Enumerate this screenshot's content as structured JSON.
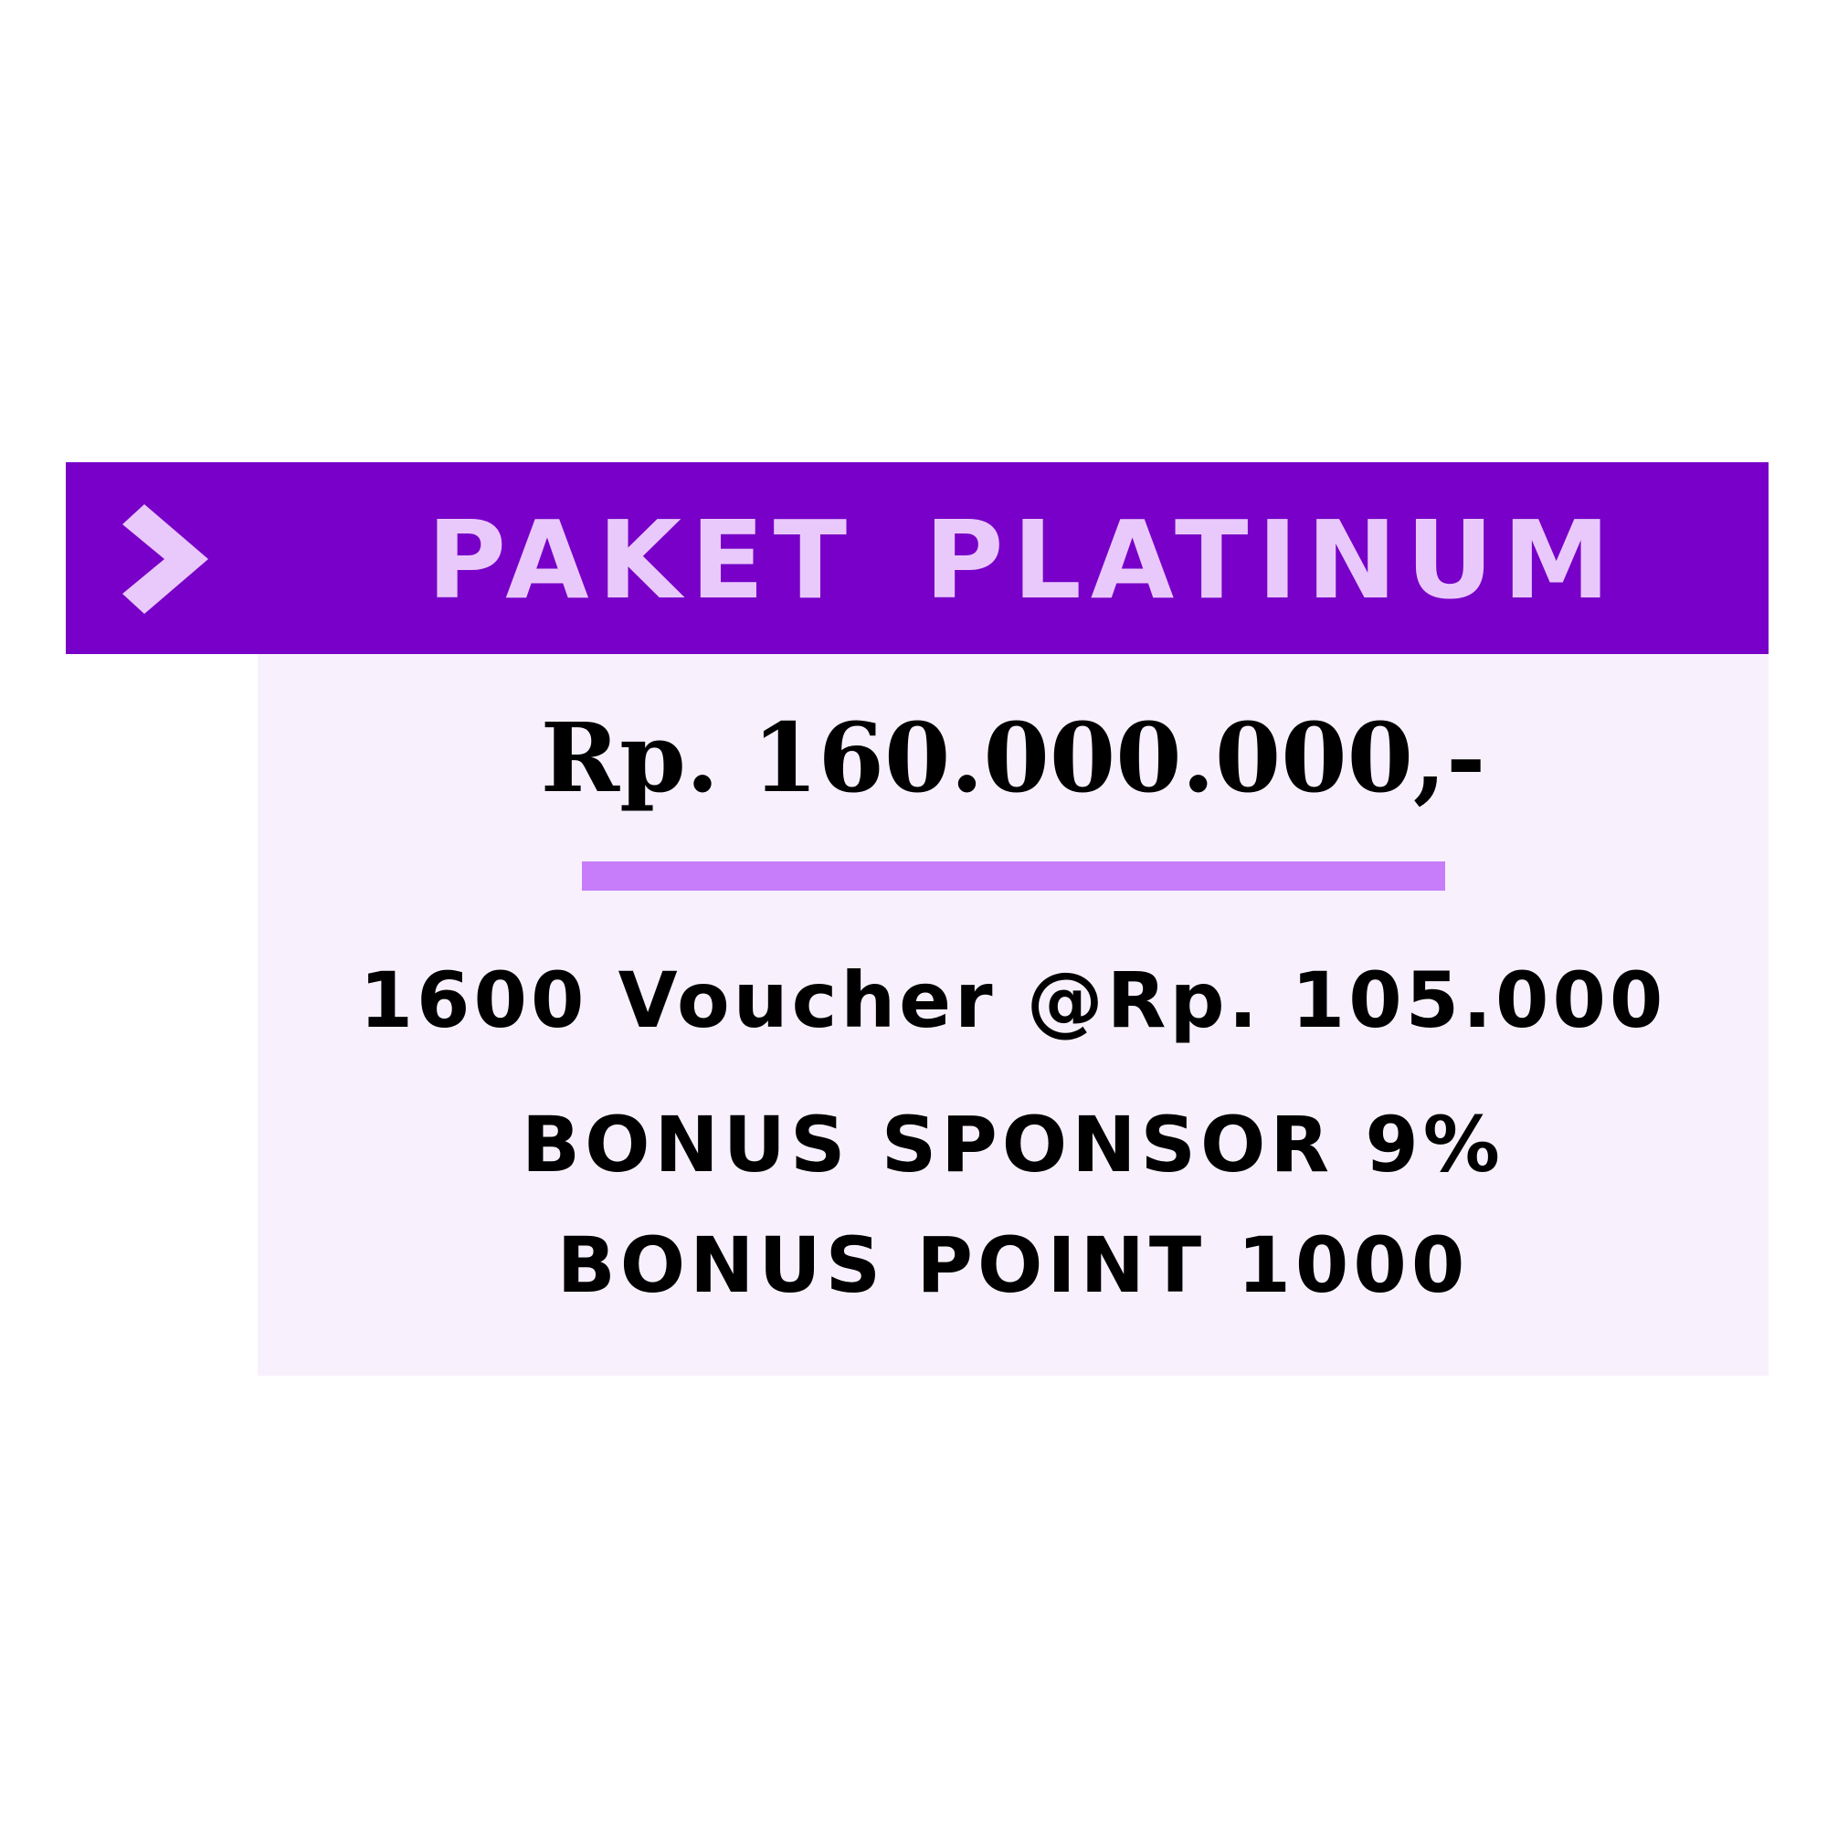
{
  "header": {
    "title": "PAKET PLATINUM",
    "icon": "chevron-right-icon",
    "background_color": "#7800c8",
    "title_color": "#e9c9fb"
  },
  "package": {
    "price": "Rp. 160.000.000,-",
    "voucher": "1600 Voucher @Rp. 105.000",
    "bonus_sponsor": "BONUS SPONSOR 9%",
    "bonus_point": "BONUS POINT 1000"
  },
  "colors": {
    "panel": "#f8f1fd",
    "divider": "#c77dfa",
    "text": "#000000"
  }
}
